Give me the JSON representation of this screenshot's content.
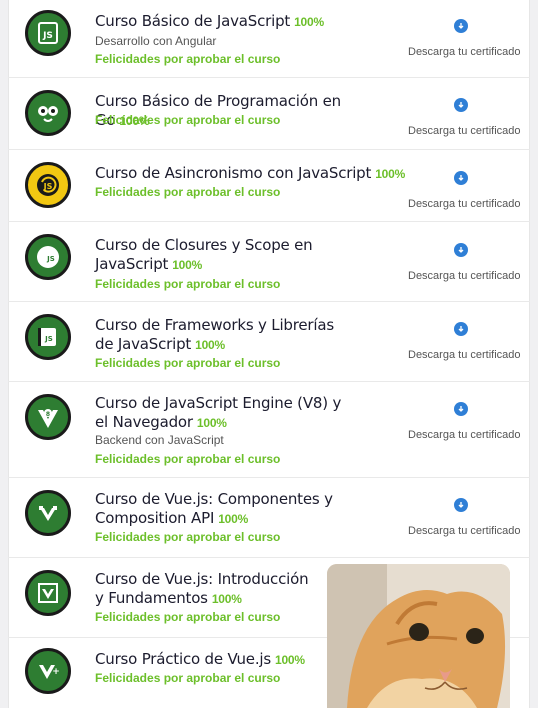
{
  "courses": [
    {
      "title": "Curso Básico de JavaScript",
      "score": "100%",
      "subtitle": "Desarrollo con Angular",
      "congrats": "Felicidades por aprobar el curso",
      "download": "Descarga tu certificado",
      "icon": "js-book-icon"
    },
    {
      "title": "Curso Básico de Programación en Go",
      "score": "100%",
      "subtitle": "",
      "congrats": "Felicidades por aprobar el curso",
      "download": "Descarga tu certificado",
      "icon": "go-gopher-icon"
    },
    {
      "title": "Curso de Asincronismo con JavaScript",
      "score": "100%",
      "subtitle": "",
      "congrats": "Felicidades por aprobar el curso",
      "download": "Descarga tu certificado",
      "icon": "js-async-icon"
    },
    {
      "title": "Curso de Closures y Scope en JavaScript",
      "score": "100%",
      "subtitle": "",
      "congrats": "Felicidades por aprobar el curso",
      "download": "Descarga tu certificado",
      "icon": "js-closures-icon"
    },
    {
      "title": "Curso de Frameworks y Librerías de JavaScript",
      "score": "100%",
      "subtitle": "",
      "congrats": "Felicidades por aprobar el curso",
      "download": "Descarga tu certificado",
      "icon": "js-book-icon"
    },
    {
      "title": "Curso de JavaScript Engine (V8) y el Navegador",
      "score": "100%",
      "subtitle": "Backend con JavaScript",
      "congrats": "Felicidades por aprobar el curso",
      "download": "Descarga tu certificado",
      "icon": "v8-engine-icon"
    },
    {
      "title": "Curso de Vue.js: Componentes y Composition API",
      "score": "100%",
      "subtitle": "",
      "congrats": "Felicidades por aprobar el curso",
      "download": "Descarga tu certificado",
      "icon": "vue-components-icon"
    },
    {
      "title": "Curso de Vue.js: Introducción y Fundamentos",
      "score": "100%",
      "subtitle": "",
      "congrats": "Felicidades por aprobar el curso",
      "download": "",
      "icon": "vue-intro-icon"
    },
    {
      "title": "Curso Práctico de Vue.js",
      "score": "100%",
      "subtitle": "",
      "congrats": "Felicidades por aprobar el curso",
      "download": "",
      "icon": "vue-practice-icon"
    }
  ],
  "colors": {
    "accent": "#6cbf2a",
    "badge": "#2e7d32",
    "download": "#2f7fd6"
  }
}
